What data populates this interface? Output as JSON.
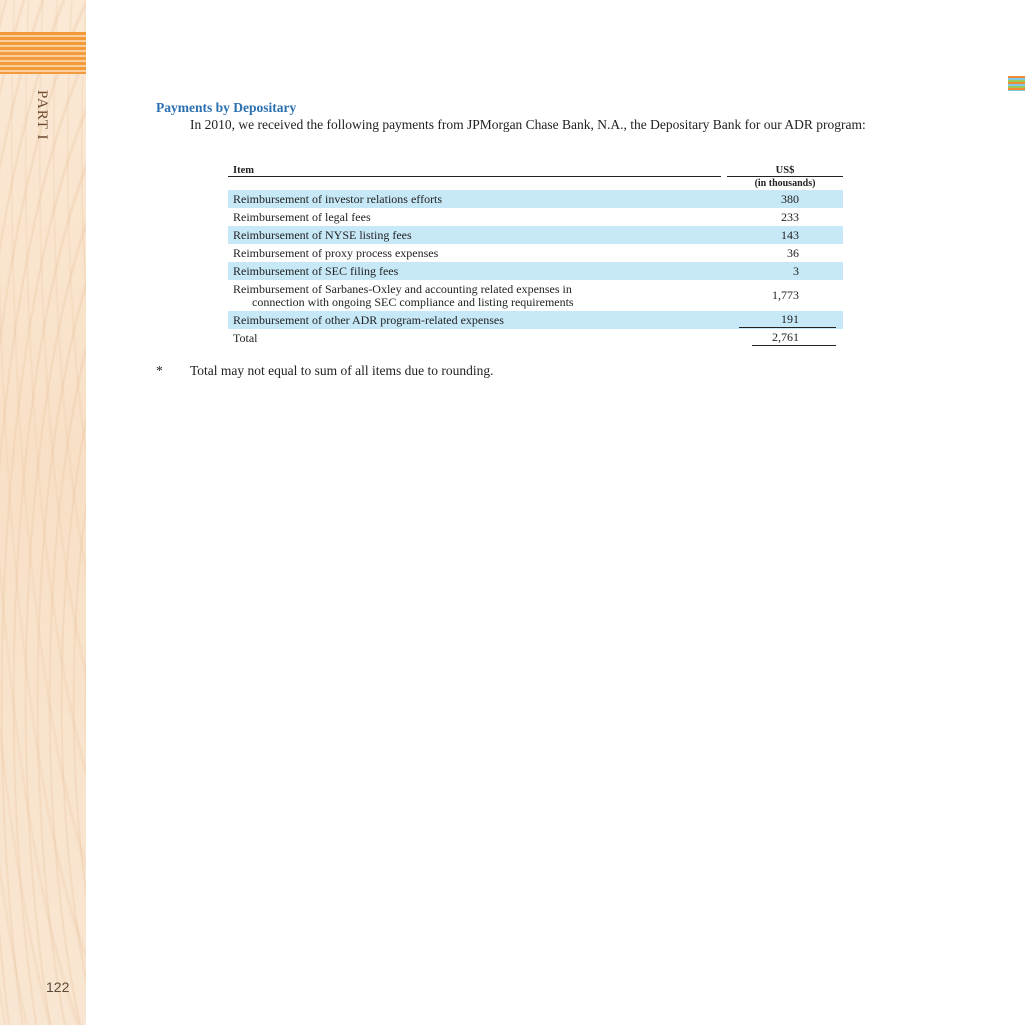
{
  "sidebar": {
    "part_label": "PART I",
    "page_number": "122",
    "accent_color": "#f39a3c",
    "background_color": "#f8e0c6"
  },
  "section": {
    "title": "Payments by Depositary",
    "title_color": "#2a70b0",
    "intro": "In 2010, we received the following payments from JPMorgan Chase Bank, N.A., the Depositary Bank for our ADR program:"
  },
  "table": {
    "header_item": "Item",
    "header_usd": "US$",
    "subheader": "(in thousands)",
    "shade_color": "#c7e9f7",
    "rows": [
      {
        "item": "Reimbursement of investor relations efforts",
        "value": "380"
      },
      {
        "item": "Reimbursement of legal fees",
        "value": "233"
      },
      {
        "item": "Reimbursement of NYSE listing fees",
        "value": "143"
      },
      {
        "item": "Reimbursement of proxy process expenses",
        "value": "36"
      },
      {
        "item": "Reimbursement of SEC filing fees",
        "value": "3"
      },
      {
        "item": "Reimbursement of Sarbanes-Oxley and accounting related expenses in",
        "item_line2": "connection with ongoing SEC compliance and listing requirements",
        "value": "1,773"
      },
      {
        "item": "Reimbursement of other ADR program-related expenses",
        "value": "191"
      }
    ],
    "total_label": "Total",
    "total_value": "2,761"
  },
  "footnote": {
    "marker": "*",
    "text": "Total may not equal to sum of all items due to rounding."
  }
}
